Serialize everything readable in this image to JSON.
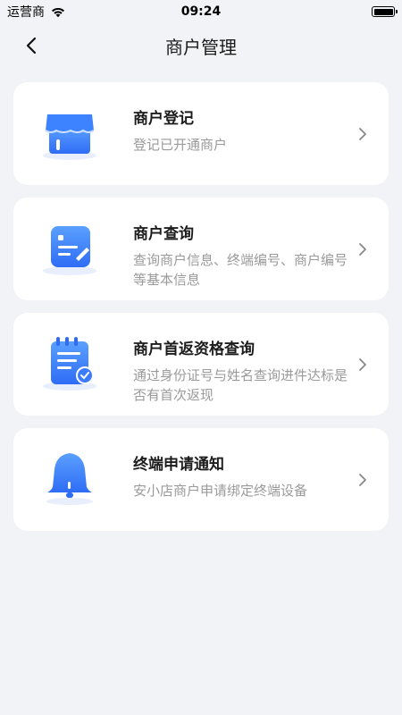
{
  "status_bar": {
    "carrier": "运营商",
    "time": "09:24"
  },
  "nav": {
    "title": "商户管理"
  },
  "items": [
    {
      "title": "商户登记",
      "desc": "登记已开通商户",
      "icon": "store-icon"
    },
    {
      "title": "商户查询",
      "desc": "查询商户信息、终端编号、商户编号等基本信息",
      "icon": "document-search-icon"
    },
    {
      "title": "商户首返资格查询",
      "desc": "通过身份证号与姓名查询进件达标是否有首次返现",
      "icon": "notebook-check-icon"
    },
    {
      "title": "终端申请通知",
      "desc": "安小店商户申请绑定终端设备",
      "icon": "bell-icon"
    }
  ],
  "colors": {
    "background": "#f2f3f7",
    "card": "#ffffff",
    "accent": "#3a7bff"
  }
}
